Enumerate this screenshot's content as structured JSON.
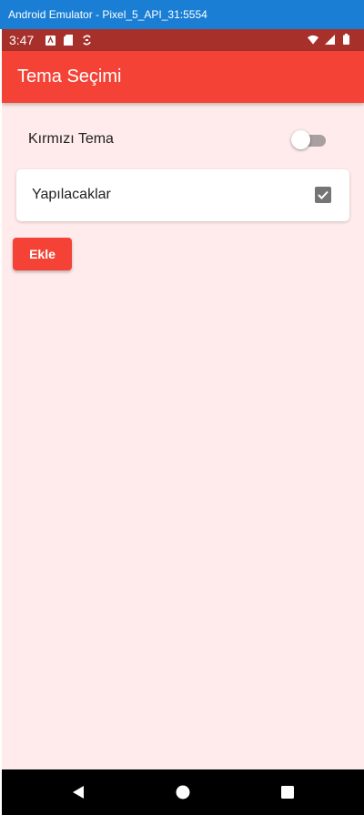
{
  "window": {
    "title": "Android Emulator - Pixel_5_API_31:5554"
  },
  "status_bar": {
    "time": "3:47",
    "left_icons": [
      "android-notification-icon",
      "sd-card-icon",
      "sync-icon"
    ],
    "right_icons": [
      "wifi-icon",
      "signal-icon",
      "battery-icon"
    ]
  },
  "app_bar": {
    "title": "Tema Seçimi",
    "color": "#f44336"
  },
  "settings": {
    "red_theme_label": "Kırmızı Tema",
    "red_theme_enabled": false
  },
  "todo": {
    "label": "Yapılacaklar",
    "checked": true
  },
  "actions": {
    "add_label": "Ekle"
  },
  "nav": {
    "buttons": [
      "back-icon",
      "home-icon",
      "recents-icon"
    ]
  },
  "colors": {
    "background": "#ffebeb",
    "accent": "#f44336",
    "status_bar": "#a8302b"
  }
}
